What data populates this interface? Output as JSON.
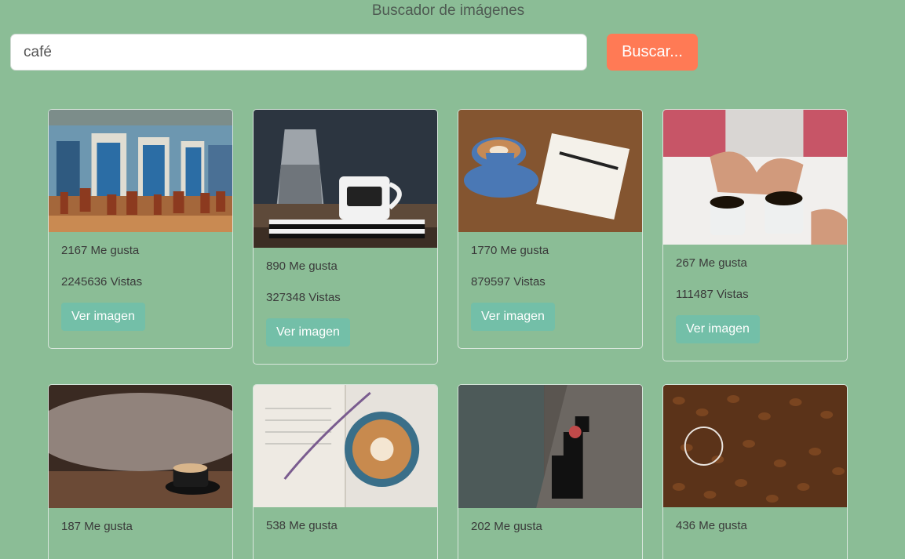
{
  "app": {
    "title": "Buscador de imágenes"
  },
  "search": {
    "value": "café",
    "button_label": "Buscar..."
  },
  "results": [
    {
      "likes": "2167 Me gusta",
      "views": "2245636 Vistas",
      "button": "Ver imagen",
      "subject": "street-cafe-facade"
    },
    {
      "likes": "890 Me gusta",
      "views": "327348 Vistas",
      "button": "Ver imagen",
      "subject": "moka-pot-and-cup"
    },
    {
      "likes": "1770 Me gusta",
      "views": "879597 Vistas",
      "button": "Ver imagen",
      "subject": "latte-and-notebook"
    },
    {
      "likes": "267 Me gusta",
      "views": "111487 Vistas",
      "button": "Ver imagen",
      "subject": "hands-with-coffee-cups"
    },
    {
      "likes": "187 Me gusta",
      "views": "",
      "button": "",
      "subject": "latte-on-table-smoke"
    },
    {
      "likes": "538 Me gusta",
      "views": "",
      "button": "",
      "subject": "cappuccino-on-book"
    },
    {
      "likes": "202 Me gusta",
      "views": "",
      "button": "",
      "subject": "canal-side-cafe"
    },
    {
      "likes": "436 Me gusta",
      "views": "",
      "button": "",
      "subject": "coffee-beans"
    }
  ]
}
